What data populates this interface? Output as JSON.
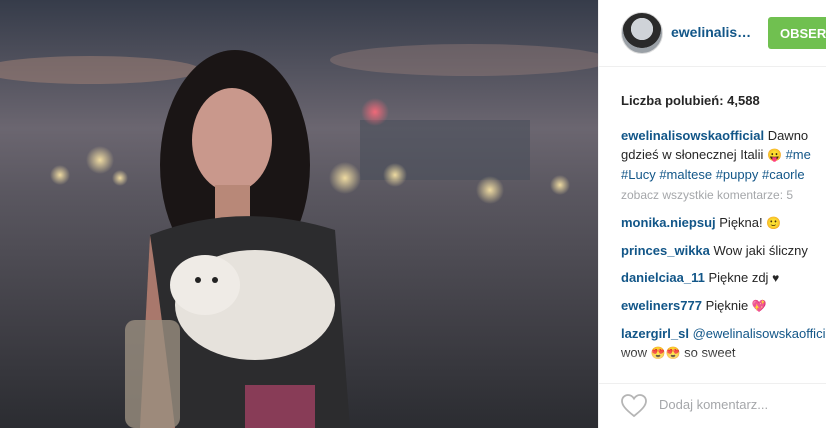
{
  "post": {
    "username": "ewelinalis…",
    "follow_label": "OBSERWUJ",
    "likes_text": "Liczba polubień: 4,588"
  },
  "caption": {
    "username": "ewelinalisowskaofficial",
    "text_1": "Dawno",
    "text_2": "gdzieś w słonecznej Italii",
    "emoji_1": "😛",
    "tag_1": "#me",
    "tag_2": "#Lucy",
    "tag_3": "#maltese",
    "tag_4": "#puppy",
    "tag_5": "#caorle"
  },
  "see_all": "zobacz wszystkie komentarze: 5",
  "comments": [
    {
      "user": "monika.niepsuj",
      "text": "Piękna!",
      "emoji": "🙂"
    },
    {
      "user": "princes_wikka",
      "text": "Wow jaki śliczny",
      "emoji": ""
    },
    {
      "user": "danielciaa_11",
      "text": "Piękne zdj",
      "emoji": "♥"
    },
    {
      "user": "eweliners777",
      "text": "Pięknie",
      "emoji": "💖"
    },
    {
      "user": "lazergirl_sl",
      "text": "@ewelinalisowskaofficial",
      "emoji": ""
    }
  ],
  "comment_continuation": {
    "text": "wow",
    "emoji": "😍😍",
    "text_2": "so sweet"
  },
  "add_comment_placeholder": "Dodaj komentarz...",
  "colors": {
    "follow": "#70c050",
    "link": "#125688",
    "muted": "#a5a7aa"
  }
}
